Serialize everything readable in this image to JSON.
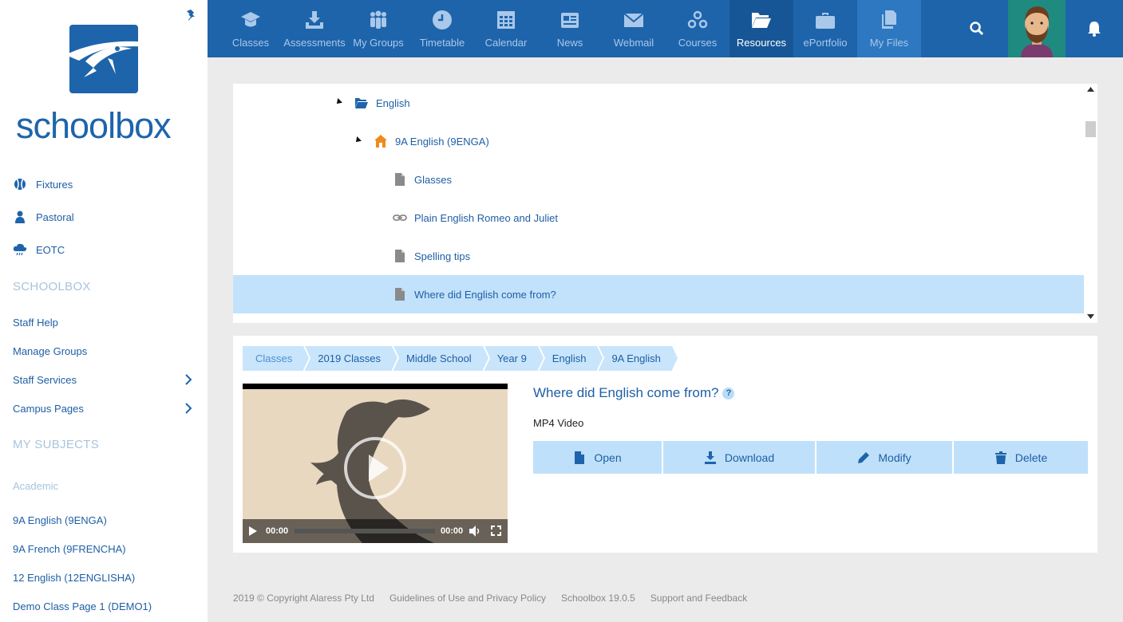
{
  "sidebar": {
    "brand": "schoolbox",
    "quick_links": [
      {
        "label": "Fixtures",
        "icon": "fixtures-icon"
      },
      {
        "label": "Pastoral",
        "icon": "person-icon"
      },
      {
        "label": "EOTC",
        "icon": "cloud-icon"
      }
    ],
    "schoolbox_heading": "SCHOOLBOX",
    "schoolbox_links": [
      {
        "label": "Staff Help"
      },
      {
        "label": "Manage Groups"
      },
      {
        "label": "Staff Services"
      },
      {
        "label": "Campus Pages"
      }
    ],
    "subjects_heading": "MY SUBJECTS",
    "subjects_subheading": "Academic",
    "subjects": [
      {
        "label": "9A English (9ENGA)"
      },
      {
        "label": "9A French (9FRENCHA)"
      },
      {
        "label": "12 English (12ENGLISHA)"
      },
      {
        "label": "Demo Class Page 1 (DEMO1)"
      }
    ]
  },
  "topnav": {
    "items": [
      {
        "label": "Classes",
        "icon": "graduation-cap-icon"
      },
      {
        "label": "Assessments",
        "icon": "download-tray-icon"
      },
      {
        "label": "My Groups",
        "icon": "group-icon"
      },
      {
        "label": "Timetable",
        "icon": "clock-icon"
      },
      {
        "label": "Calendar",
        "icon": "calendar-icon"
      },
      {
        "label": "News",
        "icon": "news-icon"
      },
      {
        "label": "Webmail",
        "icon": "envelope-icon"
      },
      {
        "label": "Courses",
        "icon": "courses-icon"
      },
      {
        "label": "Resources",
        "icon": "folder-open-icon"
      },
      {
        "label": "ePortfolio",
        "icon": "briefcase-icon"
      },
      {
        "label": "My Files",
        "icon": "files-icon"
      }
    ],
    "active": "Resources"
  },
  "tree": {
    "rows": [
      {
        "label": "English",
        "icon": "folder-open-icon"
      },
      {
        "label": "9A English (9ENGA)",
        "icon": "home-icon"
      },
      {
        "label": "Glasses",
        "icon": "file-icon"
      },
      {
        "label": "Plain English Romeo and Juliet",
        "icon": "link-icon"
      },
      {
        "label": "Spelling tips",
        "icon": "file-icon"
      },
      {
        "label": "Where did English come from?",
        "icon": "file-icon"
      }
    ]
  },
  "detail": {
    "breadcrumbs": [
      "Classes",
      "2019 Classes",
      "Middle School",
      "Year 9",
      "English",
      "9A English"
    ],
    "title": "Where did English come from?",
    "help": "?",
    "type": "MP4 Video",
    "video": {
      "current": "00:00",
      "duration": "00:00"
    },
    "actions": [
      {
        "label": "Open",
        "icon": "file-icon"
      },
      {
        "label": "Download",
        "icon": "download-icon"
      },
      {
        "label": "Modify",
        "icon": "pencil-icon"
      },
      {
        "label": "Delete",
        "icon": "trash-icon"
      }
    ]
  },
  "footer": {
    "copyright": "2019 © Copyright Alaress Pty Ltd",
    "guidelines": "Guidelines of Use and Privacy Policy",
    "version": "Schoolbox 19.0.5",
    "support": "Support and Feedback"
  },
  "colors": {
    "brand": "#1e64ab",
    "active_nav": "#175696",
    "selected_row": "#c2e2fb",
    "action_bg": "#bfe0fa",
    "home_icon": "#f08a1d"
  }
}
